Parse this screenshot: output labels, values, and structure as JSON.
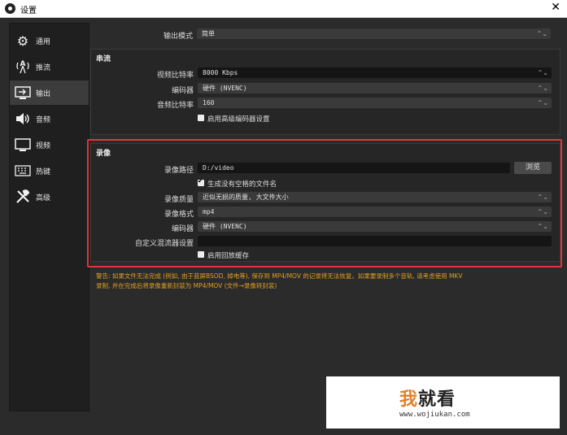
{
  "window": {
    "title": "设置",
    "close_glyph": "✕",
    "app_icon": "obs-logo-icon"
  },
  "sidebar": {
    "items": [
      {
        "label": "通用",
        "icon": "gear-icon",
        "glyph": "⚙",
        "active": false
      },
      {
        "label": "推流",
        "icon": "antenna-icon",
        "glyph": "📡",
        "active": false
      },
      {
        "label": "输出",
        "icon": "monitor-output-icon",
        "glyph": "🖥",
        "active": true
      },
      {
        "label": "音频",
        "icon": "speaker-icon",
        "glyph": "🔊",
        "active": false
      },
      {
        "label": "视频",
        "icon": "monitor-icon",
        "glyph": "🖵",
        "active": false
      },
      {
        "label": "热键",
        "icon": "keyboard-icon",
        "glyph": "⌨",
        "active": false
      },
      {
        "label": "高级",
        "icon": "tools-icon",
        "glyph": "🛠",
        "active": false
      }
    ]
  },
  "output_mode": {
    "label": "输出模式",
    "value": "简单"
  },
  "streaming": {
    "title": "串流",
    "video_bitrate": {
      "label": "视频比特率",
      "value": "8000 Kbps"
    },
    "encoder": {
      "label": "编码器",
      "value": "硬件 (NVENC)"
    },
    "audio_bitrate": {
      "label": "音频比特率",
      "value": "160"
    },
    "advanced_encoder": {
      "label": "启用高级编码器设置",
      "checked": false
    }
  },
  "recording": {
    "title": "录像",
    "path": {
      "label": "录像路径",
      "value": "D:/video",
      "browse": "浏览"
    },
    "no_space_filename": {
      "label": "生成没有空格的文件名",
      "checked": true
    },
    "quality": {
      "label": "录像质量",
      "value": "近似无损的质量, 大文件大小"
    },
    "format": {
      "label": "录像格式",
      "value": "mp4"
    },
    "encoder": {
      "label": "编码器",
      "value": "硬件 (NVENC)"
    },
    "custom_muxer": {
      "label": "自定义混流器设置",
      "value": ""
    },
    "replay_buffer": {
      "label": "启用回放缓存",
      "checked": false
    }
  },
  "warning": {
    "line1": "警告: 如果文件无法完成 (例如, 由于蓝屏BSOD, 掉电等), 保存到 MP4/MOV 的记录将无法恢复。如果要录制多个音轨, 请考虑使用 MKV",
    "line2": "录制, 并在完成后将录像重新封装为 MP4/MOV (文件→录像转封装)",
    "color": "#e0a020"
  },
  "colors": {
    "highlight_border": "#e0353a",
    "background": "#2b2b2b"
  },
  "watermark": {
    "title_prefix": "我",
    "title_rest": "就看",
    "url": "www.wojiukan.com"
  }
}
